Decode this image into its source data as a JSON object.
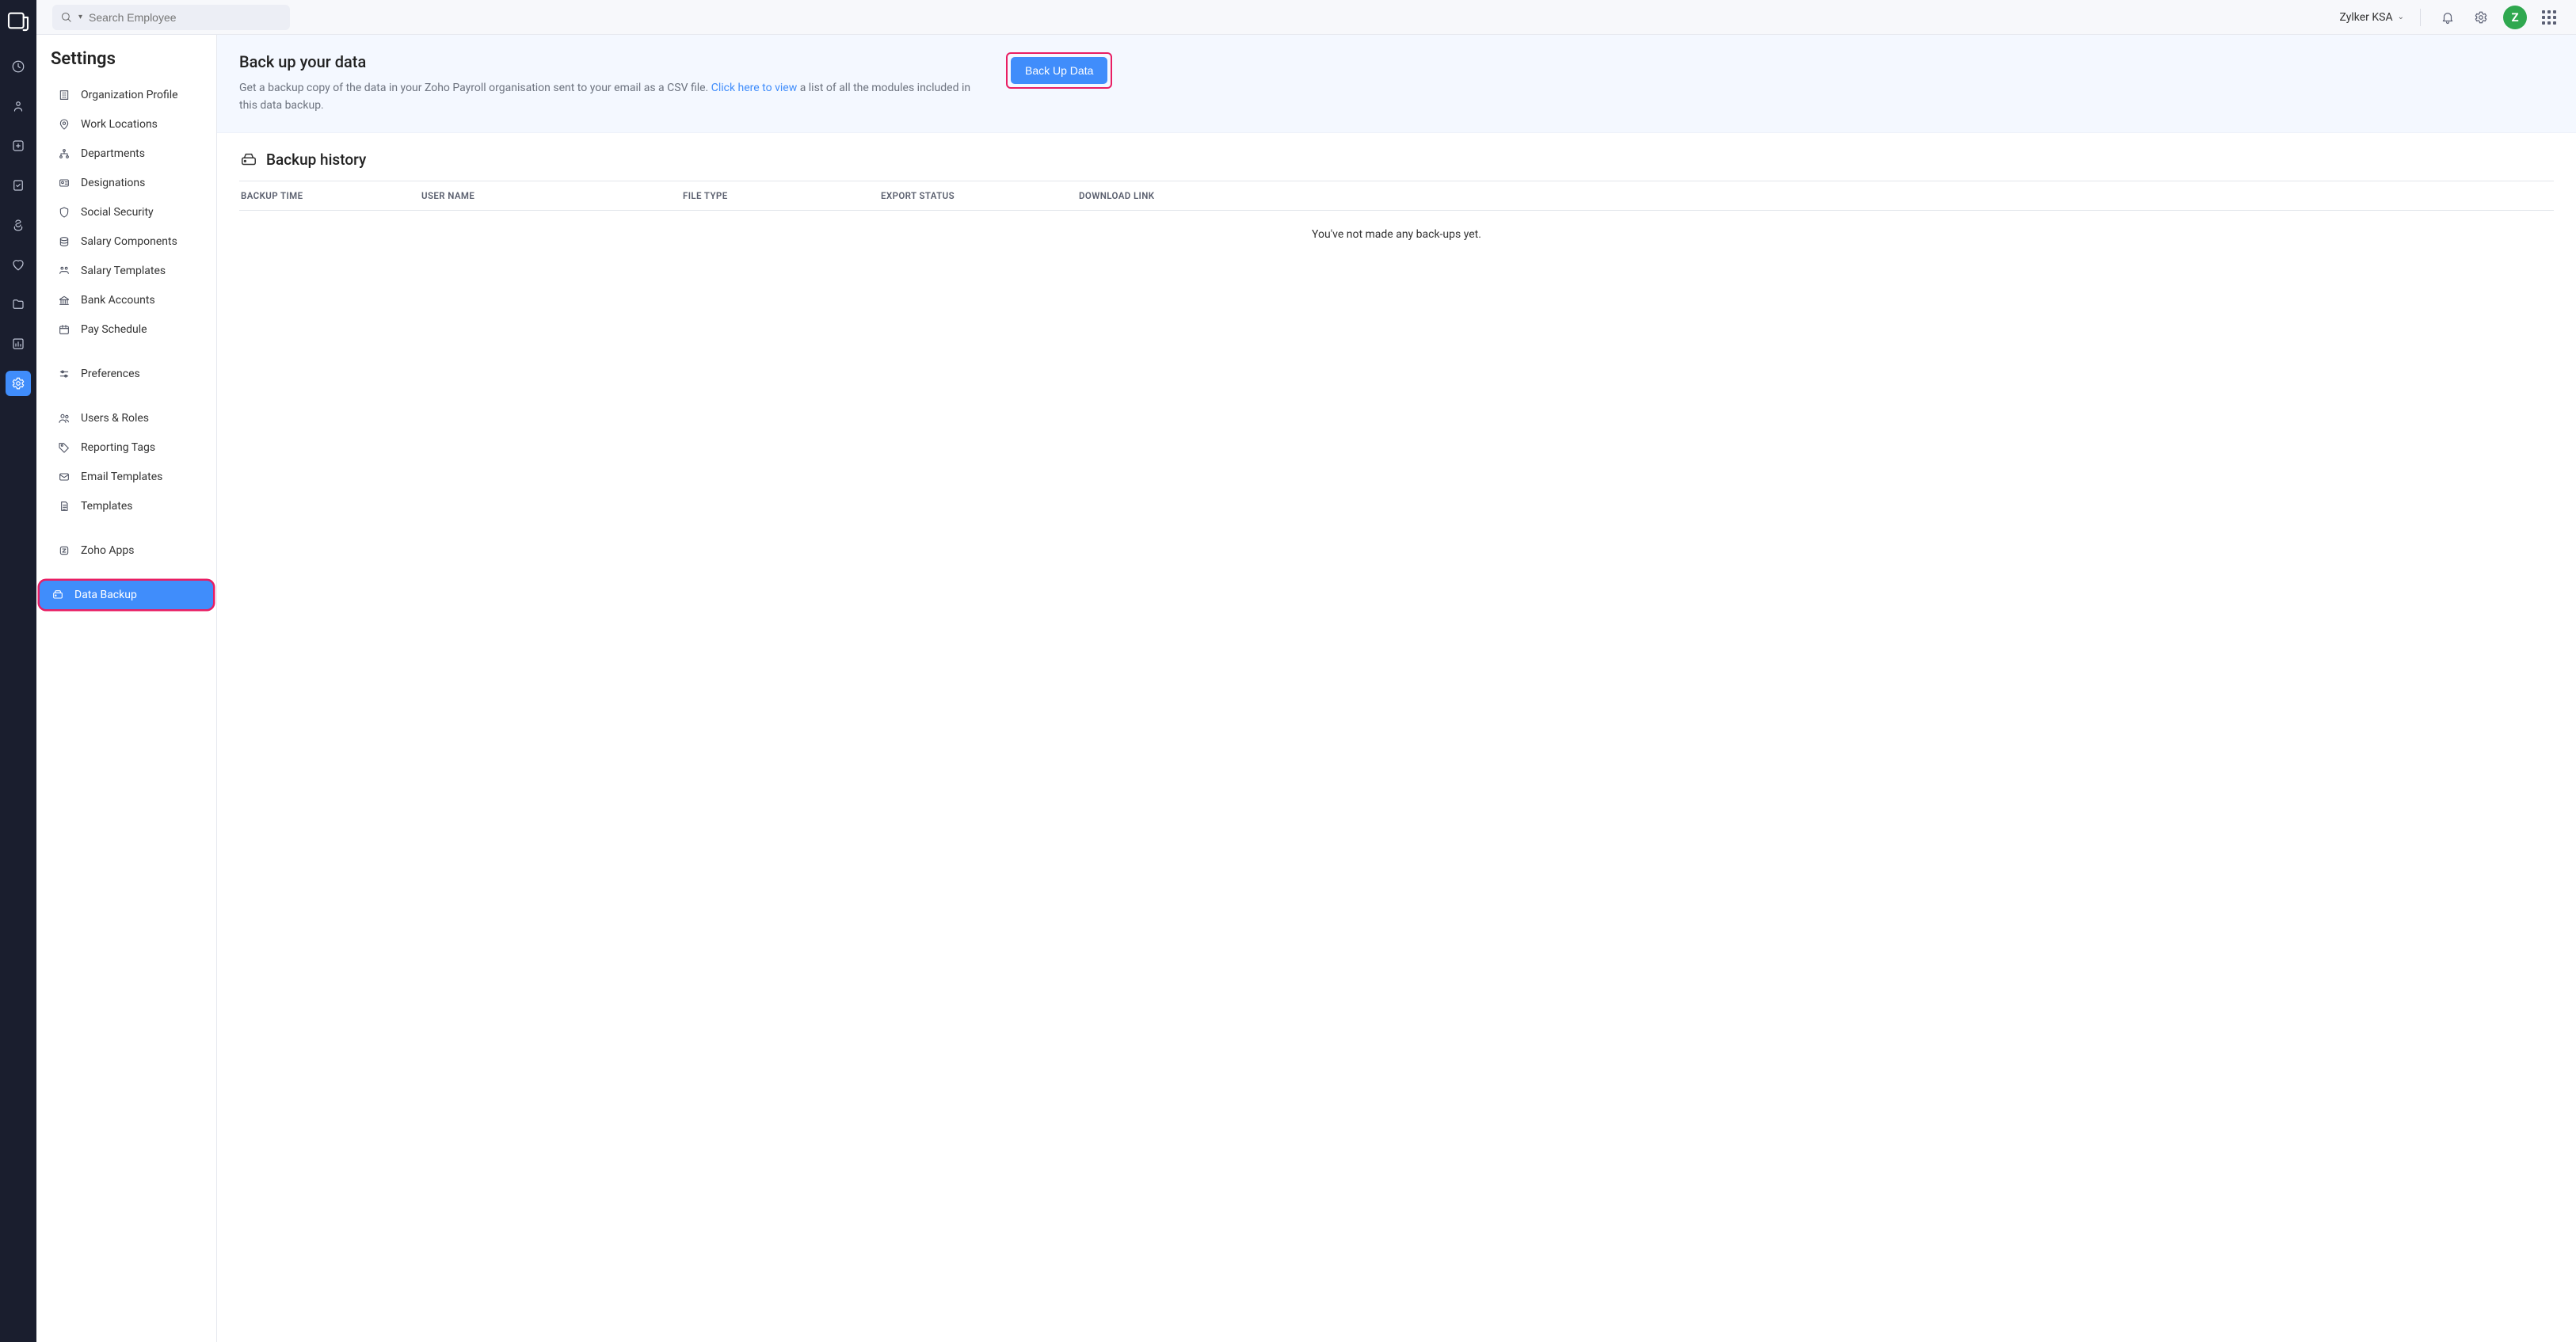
{
  "topbar": {
    "search_placeholder": "Search Employee",
    "org_name": "Zylker KSA",
    "avatar_initial": "Z"
  },
  "sidebar": {
    "title": "Settings",
    "items": [
      {
        "label": "Organization Profile"
      },
      {
        "label": "Work Locations"
      },
      {
        "label": "Departments"
      },
      {
        "label": "Designations"
      },
      {
        "label": "Social Security"
      },
      {
        "label": "Salary Components"
      },
      {
        "label": "Salary Templates"
      },
      {
        "label": "Bank Accounts"
      },
      {
        "label": "Pay Schedule"
      },
      {
        "label": "Preferences"
      },
      {
        "label": "Users & Roles"
      },
      {
        "label": "Reporting Tags"
      },
      {
        "label": "Email Templates"
      },
      {
        "label": "Templates"
      },
      {
        "label": "Zoho Apps"
      },
      {
        "label": "Data Backup"
      }
    ]
  },
  "banner": {
    "title": "Back up your data",
    "desc_prefix": "Get a backup copy of the data in your Zoho Payroll organisation sent to your email as a CSV file. ",
    "link_text": "Click here to view",
    "desc_suffix": " a list of all the modules included in this data backup.",
    "button": "Back Up Data"
  },
  "history": {
    "title": "Backup history",
    "columns": {
      "c1": "BACKUP TIME",
      "c2": "USER NAME",
      "c3": "FILE TYPE",
      "c4": "EXPORT STATUS",
      "c5": "DOWNLOAD LINK"
    },
    "empty": "You've not made any back-ups yet."
  }
}
